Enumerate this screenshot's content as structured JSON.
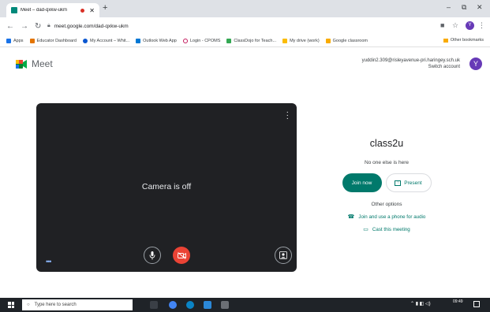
{
  "browser": {
    "tab_title": "Meet – dad-qxkw-ukm",
    "new_tab": "+",
    "url": "meet.google.com/dad-qxkw-ukm",
    "bookmarks": [
      "Apps",
      "Educator Dashboard",
      "My Account – Whit...",
      "Outlook Web App",
      "Login - CPOMS",
      "ClassDojo for Teach...",
      "My drive (work)",
      "Google classroom"
    ],
    "other_bookmarks": "Other bookmarks",
    "profile_initial": "Y",
    "window_controls": [
      "–",
      "⧉",
      "✕"
    ]
  },
  "meet": {
    "brand": "Meet",
    "account_email": "yuddin2.309@risleyavenue-pri.haringey.sch.uk",
    "switch_account": "Switch account",
    "avatar_initial": "Y",
    "camera_status": "Camera is off",
    "meeting_name": "class2u",
    "participants_status": "No one else is here",
    "join_label": "Join now",
    "present_label": "Present",
    "other_options": "Other options",
    "phone_audio": "Join and use a phone for audio",
    "cast_meeting": "Cast this meeting"
  },
  "taskbar": {
    "search_placeholder": "Type here to search",
    "time": "09:49"
  },
  "colors": {
    "accent": "#00796b",
    "preview_bg": "#202124",
    "camera_off_red": "#ea4335",
    "avatar": "#673ab7"
  }
}
